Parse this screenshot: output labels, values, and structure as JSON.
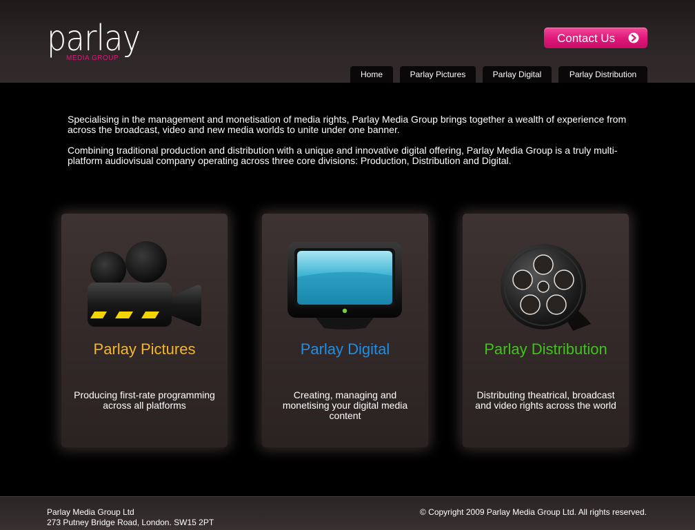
{
  "brand": {
    "name": "parlay",
    "subtitle": "media group",
    "accent_color": "#e2157c"
  },
  "header": {
    "contact_button": {
      "label": "Contact Us",
      "icon": "arrow-circle-icon"
    },
    "nav": [
      {
        "label": "Home"
      },
      {
        "label": "Parlay Pictures"
      },
      {
        "label": "Parlay Digital"
      },
      {
        "label": "Parlay Distribution"
      }
    ]
  },
  "intro": {
    "paragraphs": [
      "Specialising in the management and monetisation of media rights, Parlay Media Group brings together a wealth of experience from across the broadcast, video and new media worlds to unite under one banner.",
      "Combining traditional production and distribution with a unique and innovative digital offering, Parlay Media Group is a truly multi-platform audiovisual company operating across three core divisions: Production, Distribution and Digital."
    ]
  },
  "divisions": [
    {
      "title": "Parlay Pictures",
      "description": "Producing first-rate programming across all platforms",
      "color": "#f4b62b",
      "icon": "movie-camera-icon"
    },
    {
      "title": "Parlay Digital",
      "description": "Creating, managing and monetising your digital media content",
      "color": "#1e8fe6",
      "icon": "monitor-icon"
    },
    {
      "title": "Parlay Distribution",
      "description": "Distributing theatrical, broadcast and video rights across the world",
      "color": "#3ec41d",
      "icon": "film-reel-icon"
    }
  ],
  "footer": {
    "company": "Parlay Media Group Ltd",
    "address": "273 Putney Bridge Road, London. SW15 2PT",
    "copyright": "© Copyright 2009 Parlay Media Group Ltd. All rights reserved."
  }
}
